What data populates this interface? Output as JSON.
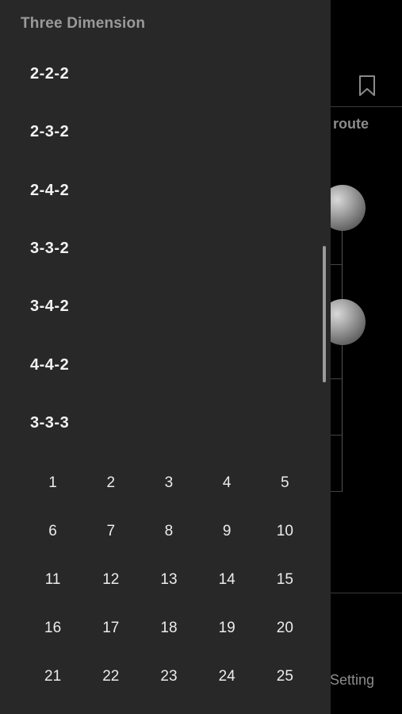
{
  "background": {
    "route_label": "route",
    "setting_label": "Setting",
    "icons": {
      "bookmark": "bookmark-icon"
    }
  },
  "drawer": {
    "title": "Three Dimension",
    "items": [
      {
        "label": "2-2-2"
      },
      {
        "label": "2-3-2"
      },
      {
        "label": "2-4-2"
      },
      {
        "label": "3-3-2"
      },
      {
        "label": "3-4-2"
      },
      {
        "label": "4-4-2"
      },
      {
        "label": "3-3-3"
      }
    ],
    "numbers": [
      "1",
      "2",
      "3",
      "4",
      "5",
      "6",
      "7",
      "8",
      "9",
      "10",
      "11",
      "12",
      "13",
      "14",
      "15",
      "16",
      "17",
      "18",
      "19",
      "20",
      "21",
      "22",
      "23",
      "24",
      "25"
    ]
  },
  "colors": {
    "drawer_bg": "#282828",
    "screen_bg": "#000000",
    "item_text": "#f2f2f2",
    "title_text": "#9a9a9a"
  }
}
